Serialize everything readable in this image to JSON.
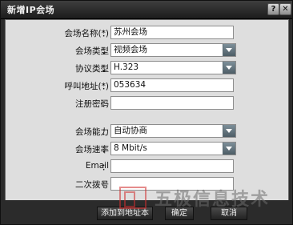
{
  "window": {
    "title": "新增IP会场"
  },
  "titlebar_buttons": [
    {
      "icon": "help-icon",
      "glyph": "?"
    },
    {
      "icon": "close-icon",
      "glyph": "✕"
    }
  ],
  "form": {
    "name": {
      "label": "会场名称(*)",
      "value": "苏州会场"
    },
    "type": {
      "label": "会场类型",
      "value": "视频会场"
    },
    "protocol": {
      "label": "协议类型",
      "value": "H.323"
    },
    "call_addr": {
      "label": "呼叫地址(*)",
      "value": "053634"
    },
    "reg_pwd": {
      "label": "注册密码",
      "value": ""
    },
    "capability": {
      "label": "会场能力",
      "value": "自动协商"
    },
    "rate": {
      "label": "会场速率",
      "value": "8 Mbit/s"
    },
    "email": {
      "label": "Email",
      "value": ""
    },
    "second_dial": {
      "label": "二次拨号",
      "value": ""
    }
  },
  "colon": "：",
  "buttons": {
    "add_to_book": "添加到地址本",
    "ok": "确定",
    "cancel": "取消"
  },
  "watermark": {
    "text": "五极信息技术"
  }
}
